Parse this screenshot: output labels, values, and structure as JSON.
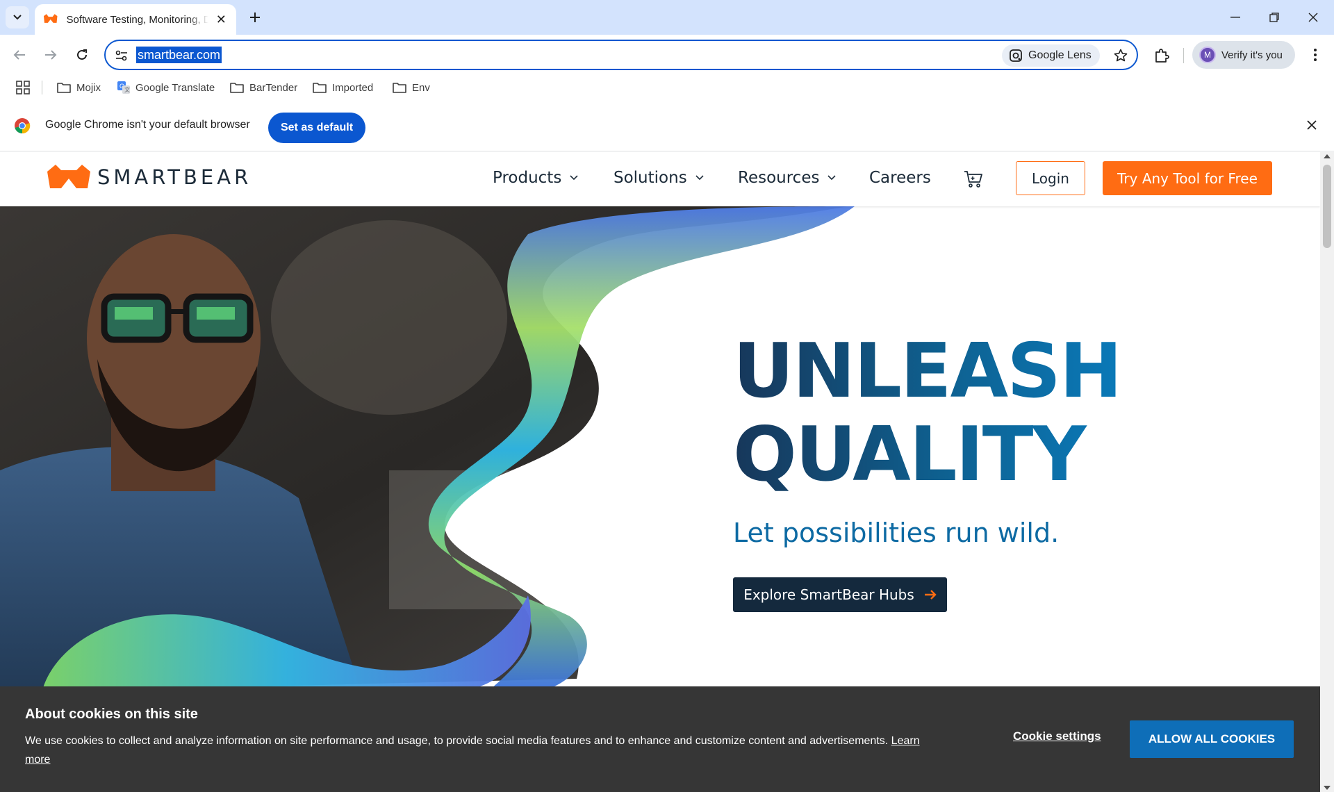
{
  "tab": {
    "title": "Software Testing, Monitoring, Develop"
  },
  "omnibox": {
    "url": "smartbear.com",
    "lens_label": "Google Lens"
  },
  "profile": {
    "initial": "M",
    "label": "Verify it's you"
  },
  "bookmarks": [
    {
      "label": "Mojix",
      "icon": "folder-icon"
    },
    {
      "label": "Google Translate",
      "icon": "google-translate-icon"
    },
    {
      "label": "BarTender",
      "icon": "folder-icon"
    },
    {
      "label": "Imported",
      "icon": "folder-icon"
    },
    {
      "label": "Env",
      "icon": "folder-icon"
    }
  ],
  "infobar": {
    "message": "Google Chrome isn't your default browser",
    "button": "Set as default"
  },
  "site": {
    "logo_text": "SMARTBEAR",
    "nav": [
      "Products",
      "Solutions",
      "Resources",
      "Careers"
    ],
    "login": "Login",
    "try_free": "Try Any Tool for Free"
  },
  "hero": {
    "title_line1": "UNLEASH",
    "title_line2": "QUALITY",
    "subtitle": "Let possibilities run wild.",
    "cta": "Explore SmartBear Hubs"
  },
  "cookie": {
    "title": "About cookies on this site",
    "text": "We use cookies to collect and analyze information on site performance and usage, to provide social media features and to enhance and customize content and advertisements.",
    "learn_more": "Learn more",
    "settings": "Cookie settings",
    "allow": "ALLOW ALL COOKIES"
  },
  "colors": {
    "brand_orange": "#ff6c13",
    "navy": "#14293d",
    "hero_blue": "#0d6aa3",
    "chrome_blue": "#0b57d0"
  }
}
